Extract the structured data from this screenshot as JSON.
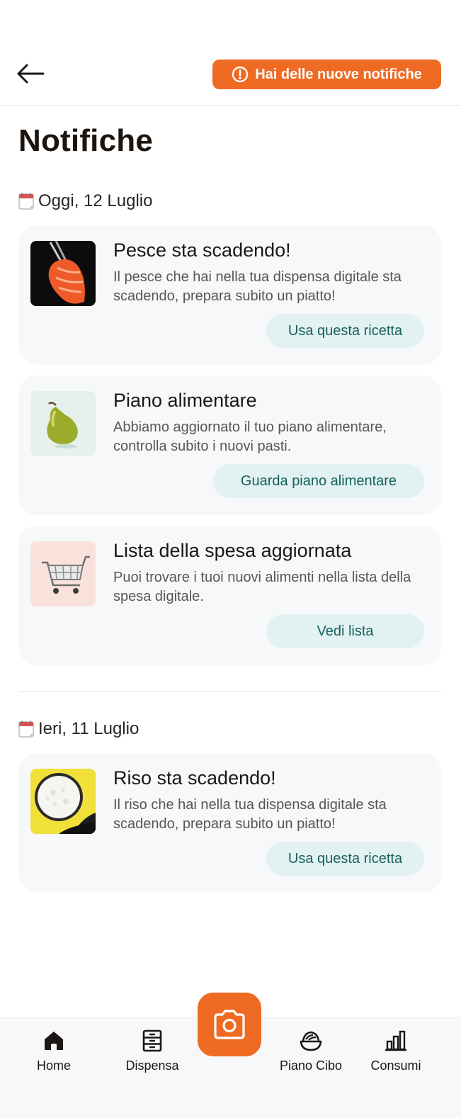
{
  "header": {
    "back_icon": "arrow-left-icon",
    "notification_banner": "Hai delle nuove notifiche",
    "notification_icon": "alert-circle-icon"
  },
  "page": {
    "title": "Notifiche"
  },
  "sections": [
    {
      "date": "Oggi, 12 Luglio",
      "items": [
        {
          "title": "Pesce sta scadendo!",
          "description": "Il pesce che hai nella tua dispensa digitale sta scadendo, prepara subito un piatto!",
          "action": "Usa questa ricetta",
          "image": "salmon-image"
        },
        {
          "title": "Piano alimentare",
          "description": "Abbiamo aggiornato il tuo piano alimentare, controlla subito i nuovi pasti.",
          "action": "Guarda piano alimentare",
          "image": "pear-image"
        },
        {
          "title": "Lista della spesa aggiornata",
          "description": "Puoi trovare i tuoi nuovi alimenti nella lista della spesa digitale.",
          "action": "Vedi lista",
          "image": "shopping-cart-image"
        }
      ]
    },
    {
      "date": "Ieri, 11 Luglio",
      "items": [
        {
          "title": "Riso sta scadendo!",
          "description": "Il riso che hai nella tua dispensa digitale sta scadendo, prepara subito un piatto!",
          "action": "Usa questa ricetta",
          "image": "rice-bowl-image"
        }
      ]
    }
  ],
  "tabbar": {
    "tabs": [
      {
        "label": "Home",
        "icon": "home-icon"
      },
      {
        "label": "Dispensa",
        "icon": "cabinet-icon"
      },
      {
        "label": "Piano Cibo",
        "icon": "bowl-icon"
      },
      {
        "label": "Consumi",
        "icon": "bar-chart-icon"
      }
    ],
    "center_action_icon": "camera-icon"
  },
  "colors": {
    "accent": "#ef6b24",
    "action_bg": "#e2f1f2",
    "action_text": "#17615c",
    "card_bg": "#f7f8fa"
  }
}
